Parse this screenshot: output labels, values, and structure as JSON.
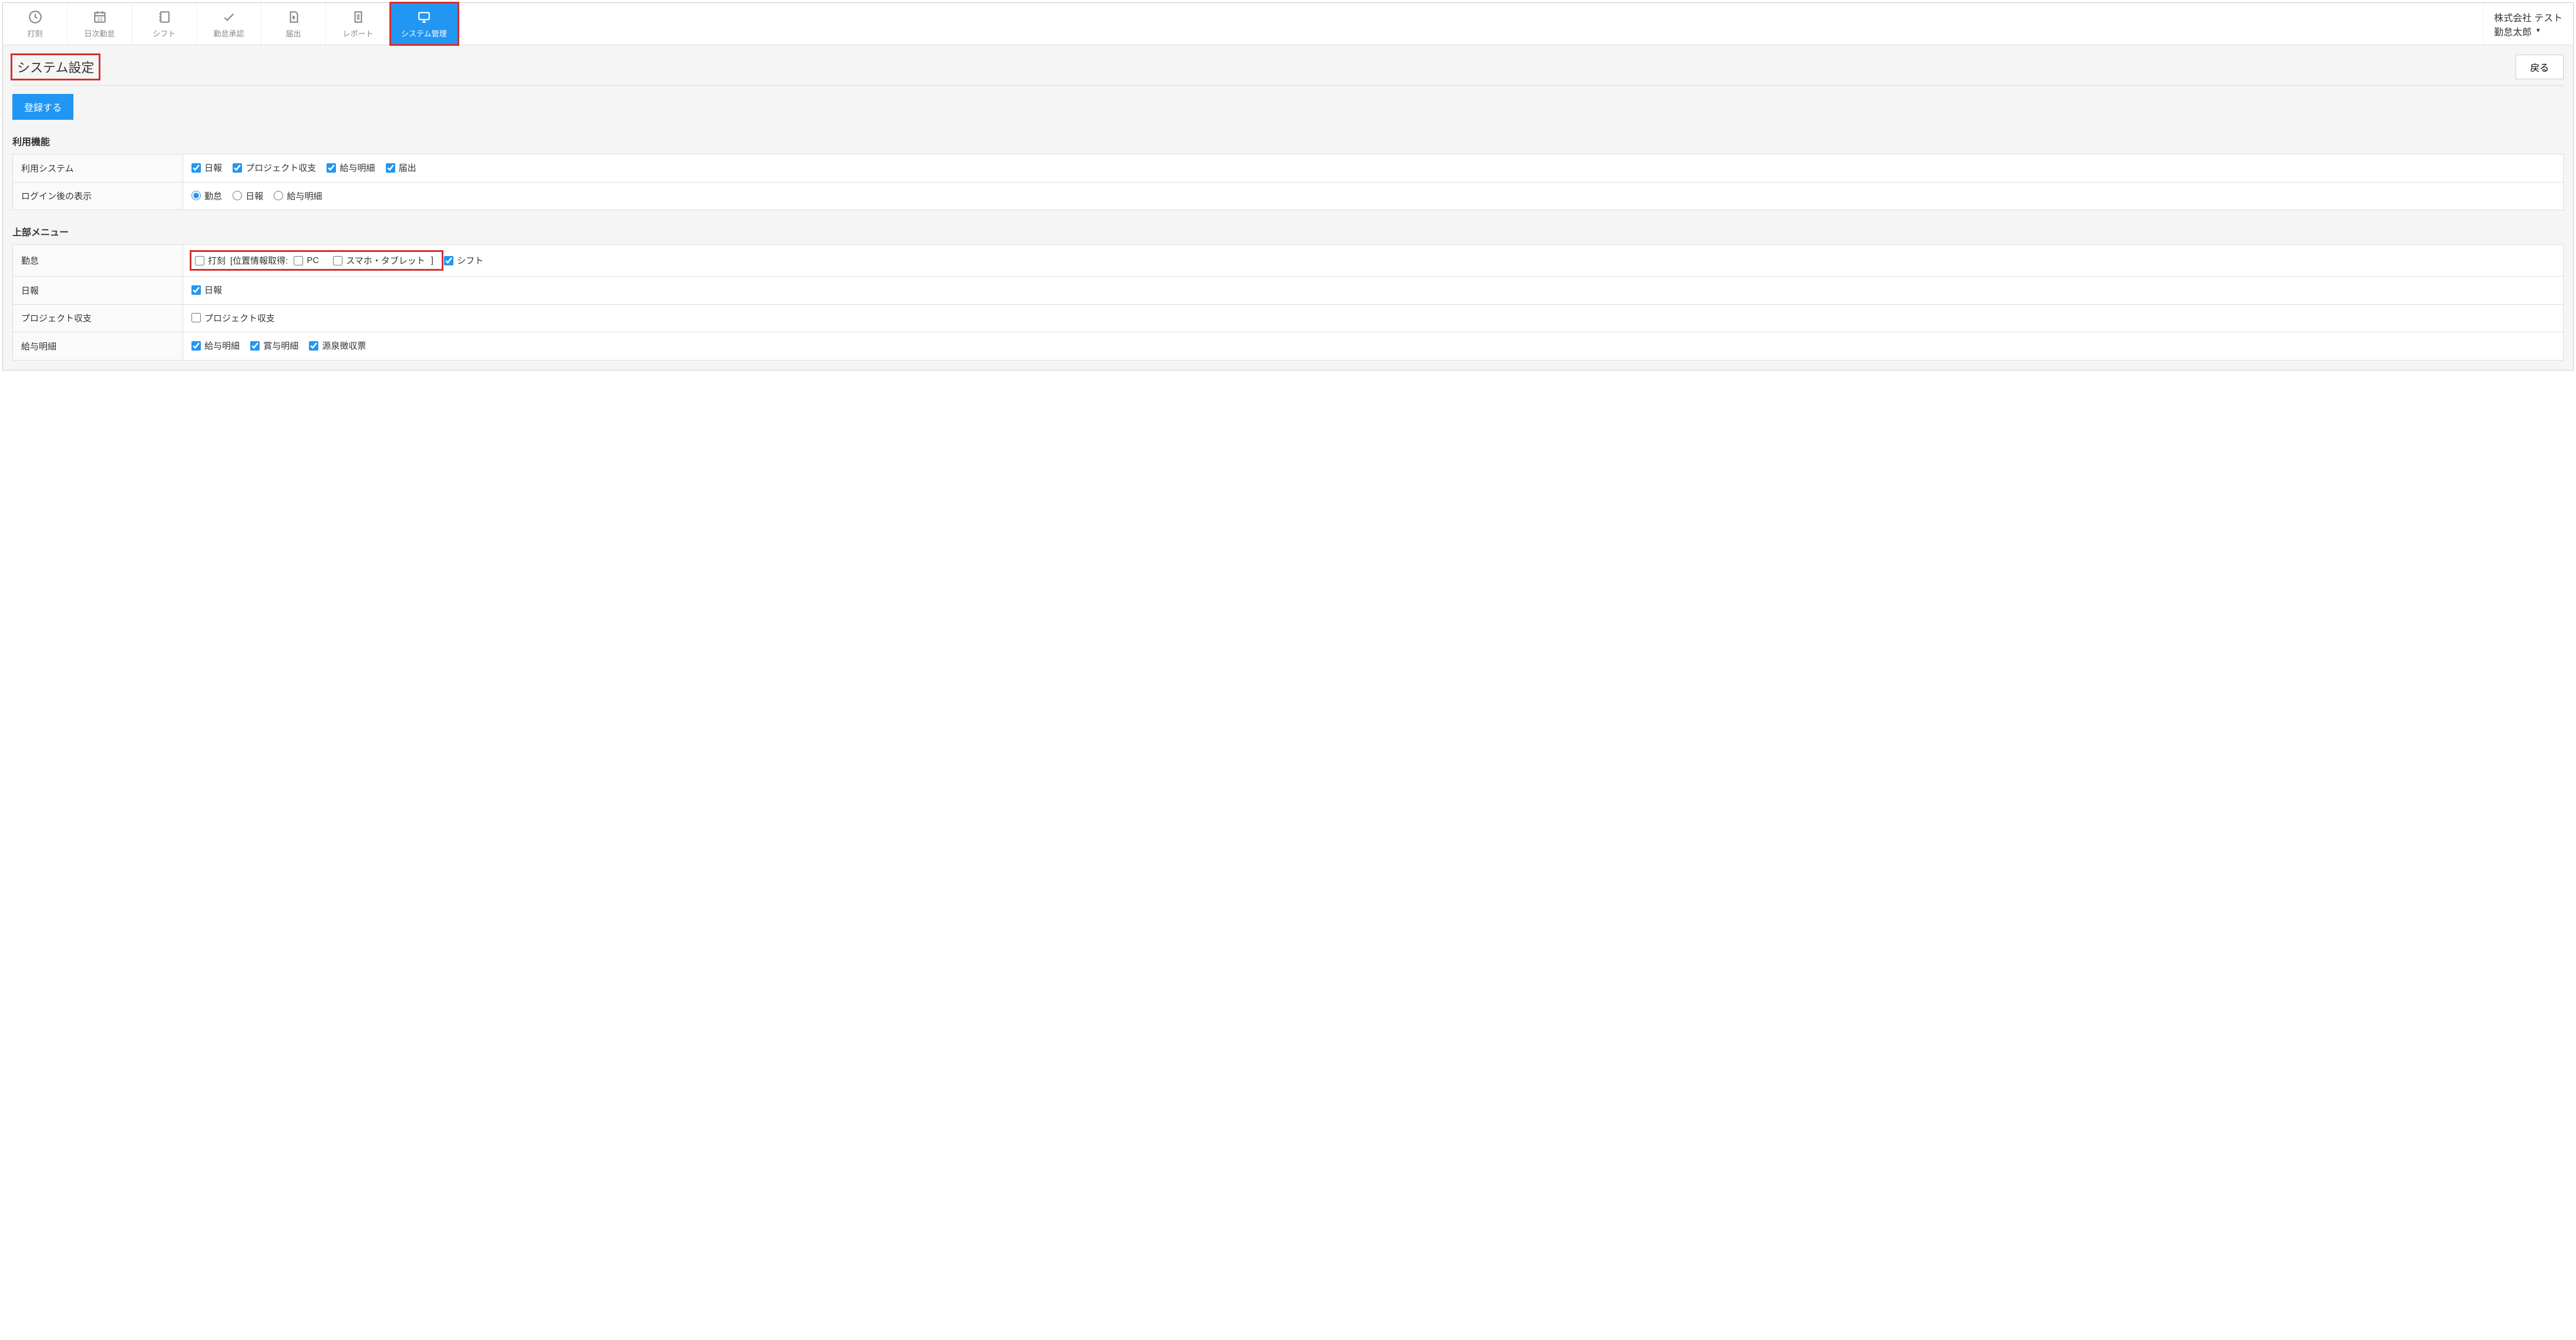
{
  "nav": {
    "items": [
      {
        "label": "打刻",
        "icon": "clock-icon"
      },
      {
        "label": "日次勤怠",
        "icon": "calendar-icon"
      },
      {
        "label": "シフト",
        "icon": "notebook-icon"
      },
      {
        "label": "勤怠承認",
        "icon": "check-icon"
      },
      {
        "label": "届出",
        "icon": "upload-doc-icon"
      },
      {
        "label": "レポート",
        "icon": "report-icon"
      },
      {
        "label": "システム管理",
        "icon": "monitor-icon",
        "active": true
      }
    ],
    "company": "株式会社 テスト",
    "username": "勤怠太郎"
  },
  "page": {
    "title": "システム設定",
    "back_label": "戻る",
    "register_label": "登録する"
  },
  "section1": {
    "title": "利用機能",
    "row1_label": "利用システム",
    "row1_opts": [
      "日報",
      "プロジェクト収支",
      "給与明細",
      "届出"
    ],
    "row2_label": "ログイン後の表示",
    "row2_opts": [
      "勤怠",
      "日報",
      "給与明細"
    ]
  },
  "section2": {
    "title": "上部メニュー",
    "row1_label": "勤怠",
    "row1_dakoku": "打刻",
    "row1_pos_prefix": "[位置情報取得:",
    "row1_pos_pc": "PC",
    "row1_pos_sp": "スマホ・タブレット",
    "row1_pos_suffix": "]",
    "row1_shift": "シフト",
    "row2_label": "日報",
    "row2_opt": "日報",
    "row3_label": "プロジェクト収支",
    "row3_opt": "プロジェクト収支",
    "row4_label": "給与明細",
    "row4_opts": [
      "給与明細",
      "賞与明細",
      "源泉徴収票"
    ]
  }
}
